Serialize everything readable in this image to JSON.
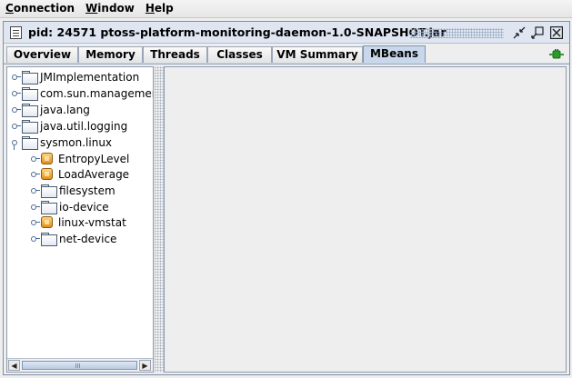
{
  "menu": {
    "items": [
      {
        "label": "Connection",
        "mnemonic": "C",
        "rest": "onnection"
      },
      {
        "label": "Window",
        "mnemonic": "W",
        "rest": "indow"
      },
      {
        "label": "Help",
        "mnemonic": "H",
        "rest": "elp"
      }
    ]
  },
  "frame": {
    "title": "pid: 24571 ptoss-platform-monitoring-daemon-1.0-SNAPSHOT.jar",
    "icons": [
      "document-icon",
      "restore-icon",
      "maximize-icon",
      "close-icon"
    ]
  },
  "tabs": [
    {
      "label": "Overview",
      "active": false
    },
    {
      "label": "Memory",
      "active": false
    },
    {
      "label": "Threads",
      "active": false
    },
    {
      "label": "Classes",
      "active": false
    },
    {
      "label": "VM Summary",
      "active": false
    },
    {
      "label": "MBeans",
      "active": true
    }
  ],
  "tree": {
    "nodes": [
      {
        "label": "JMImplementation",
        "type": "folder",
        "depth": 0,
        "expanded": false
      },
      {
        "label": "com.sun.management",
        "type": "folder",
        "depth": 0,
        "expanded": false
      },
      {
        "label": "java.lang",
        "type": "folder",
        "depth": 0,
        "expanded": false
      },
      {
        "label": "java.util.logging",
        "type": "folder",
        "depth": 0,
        "expanded": false
      },
      {
        "label": "sysmon.linux",
        "type": "folder",
        "depth": 0,
        "expanded": true
      },
      {
        "label": "EntropyLevel",
        "type": "bean",
        "depth": 1,
        "expanded": false
      },
      {
        "label": "LoadAverage",
        "type": "bean",
        "depth": 1,
        "expanded": false
      },
      {
        "label": "filesystem",
        "type": "folder",
        "depth": 1,
        "expanded": false
      },
      {
        "label": "io-device",
        "type": "folder",
        "depth": 1,
        "expanded": false
      },
      {
        "label": "linux-vmstat",
        "type": "bean",
        "depth": 1,
        "expanded": false
      },
      {
        "label": "net-device",
        "type": "folder",
        "depth": 1,
        "expanded": false
      }
    ]
  },
  "colors": {
    "accent": "#c8d8ea",
    "border": "#8e9ab0",
    "connection": "#2e9a2e"
  }
}
